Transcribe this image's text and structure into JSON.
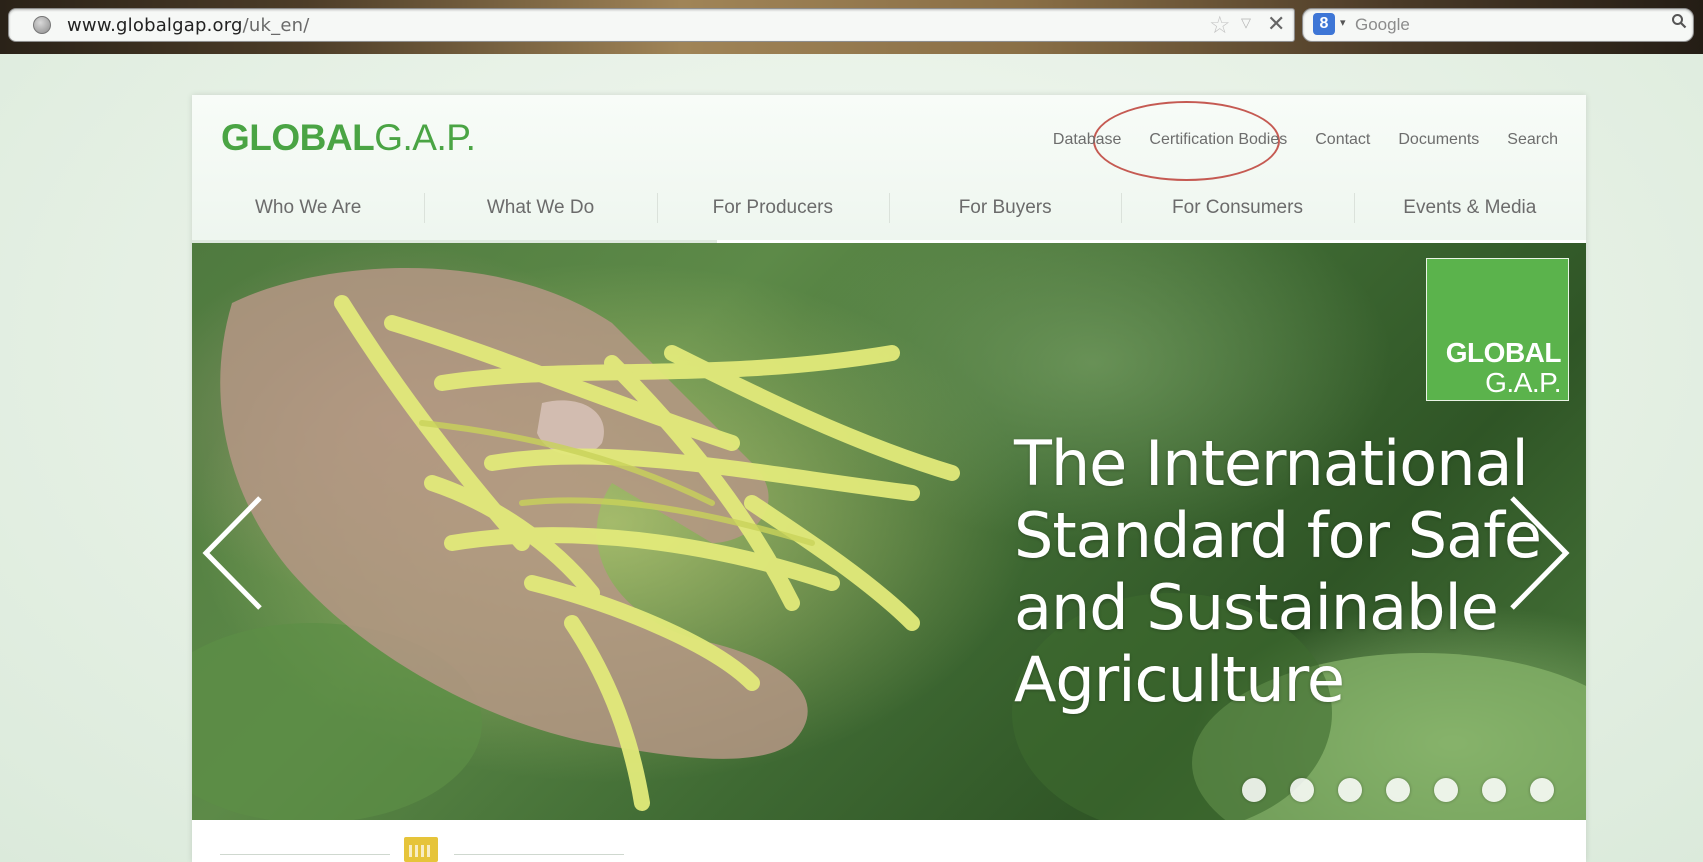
{
  "browser": {
    "url_domain": "www.globalgap.org",
    "url_path": "/uk_en/",
    "search_engine": "Google"
  },
  "site": {
    "logo_bold": "GLOBAL",
    "logo_light": "G.A.P.",
    "utility_nav": [
      "Database",
      "Certification Bodies",
      "Contact",
      "Documents",
      "Search"
    ],
    "main_nav": [
      "Who We Are",
      "What We Do",
      "For Producers",
      "For Buyers",
      "For Consumers",
      "Events & Media"
    ]
  },
  "hero": {
    "badge_line1": "GLOBAL",
    "badge_line2": "G.A.P.",
    "headline_lines": [
      "The International",
      "Standard for Safe",
      "and Sustainable",
      "Agriculture"
    ],
    "slide_count": 7
  },
  "colors": {
    "brand_green": "#4aa444",
    "annotation_ring": "#c55a52"
  }
}
